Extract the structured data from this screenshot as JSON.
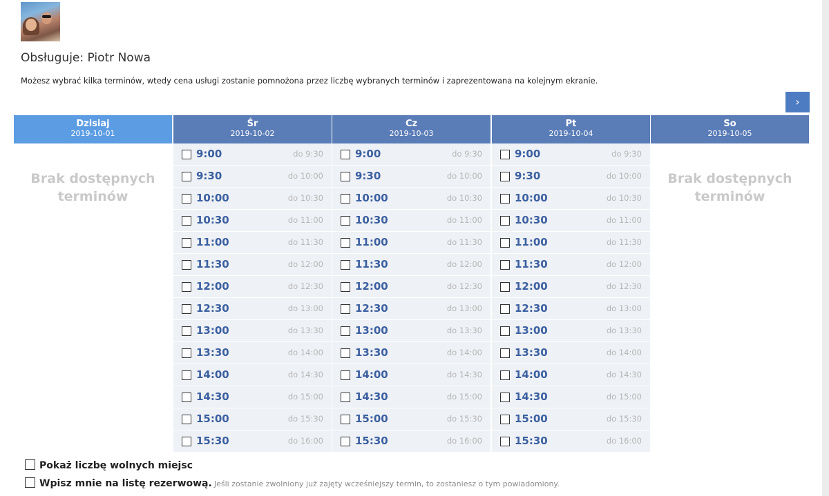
{
  "provider": {
    "label": "Obsługuje: Piotr Nowa"
  },
  "intro_text": "Możesz wybrać kilka terminów, wtedy cena usługi zostanie pomnożona przez liczbę wybranych terminów i zaprezentowana na kolejnym ekranie.",
  "nav": {
    "next_label": "›"
  },
  "empty_label_line1": "Brak dostępnych",
  "empty_label_line2": "terminów",
  "days": [
    {
      "name": "Dzisiaj",
      "date": "2019-10-01",
      "today": true,
      "available": false
    },
    {
      "name": "Śr",
      "date": "2019-10-02",
      "today": false,
      "available": true
    },
    {
      "name": "Cz",
      "date": "2019-10-03",
      "today": false,
      "available": true
    },
    {
      "name": "Pt",
      "date": "2019-10-04",
      "today": false,
      "available": true
    },
    {
      "name": "So",
      "date": "2019-10-05",
      "today": false,
      "available": false
    }
  ],
  "slots": [
    {
      "start": "9:00",
      "end": "do 9:30"
    },
    {
      "start": "9:30",
      "end": "do 10:00"
    },
    {
      "start": "10:00",
      "end": "do 10:30"
    },
    {
      "start": "10:30",
      "end": "do 11:00"
    },
    {
      "start": "11:00",
      "end": "do 11:30"
    },
    {
      "start": "11:30",
      "end": "do 12:00"
    },
    {
      "start": "12:00",
      "end": "do 12:30"
    },
    {
      "start": "12:30",
      "end": "do 13:00"
    },
    {
      "start": "13:00",
      "end": "do 13:30"
    },
    {
      "start": "13:30",
      "end": "do 14:00"
    },
    {
      "start": "14:00",
      "end": "do 14:30"
    },
    {
      "start": "14:30",
      "end": "do 15:00"
    },
    {
      "start": "15:00",
      "end": "do 15:30"
    },
    {
      "start": "15:30",
      "end": "do 16:00"
    }
  ],
  "options": {
    "show_free_label": "Pokaż liczbę wolnych miejsc",
    "waitlist_label": "Wpisz mnie na listę rezerwową.",
    "waitlist_hint": "Jeśli zostanie zwolniony już zajęty wcześniejszy termin, to zostaniesz o tym powiadomiony."
  },
  "colors": {
    "header": "#5a7cb7",
    "header_today": "#5b9ce3",
    "slot_bg": "#eef1f5",
    "slot_time": "#3b5fa0",
    "next_button": "#4e7cc2"
  }
}
